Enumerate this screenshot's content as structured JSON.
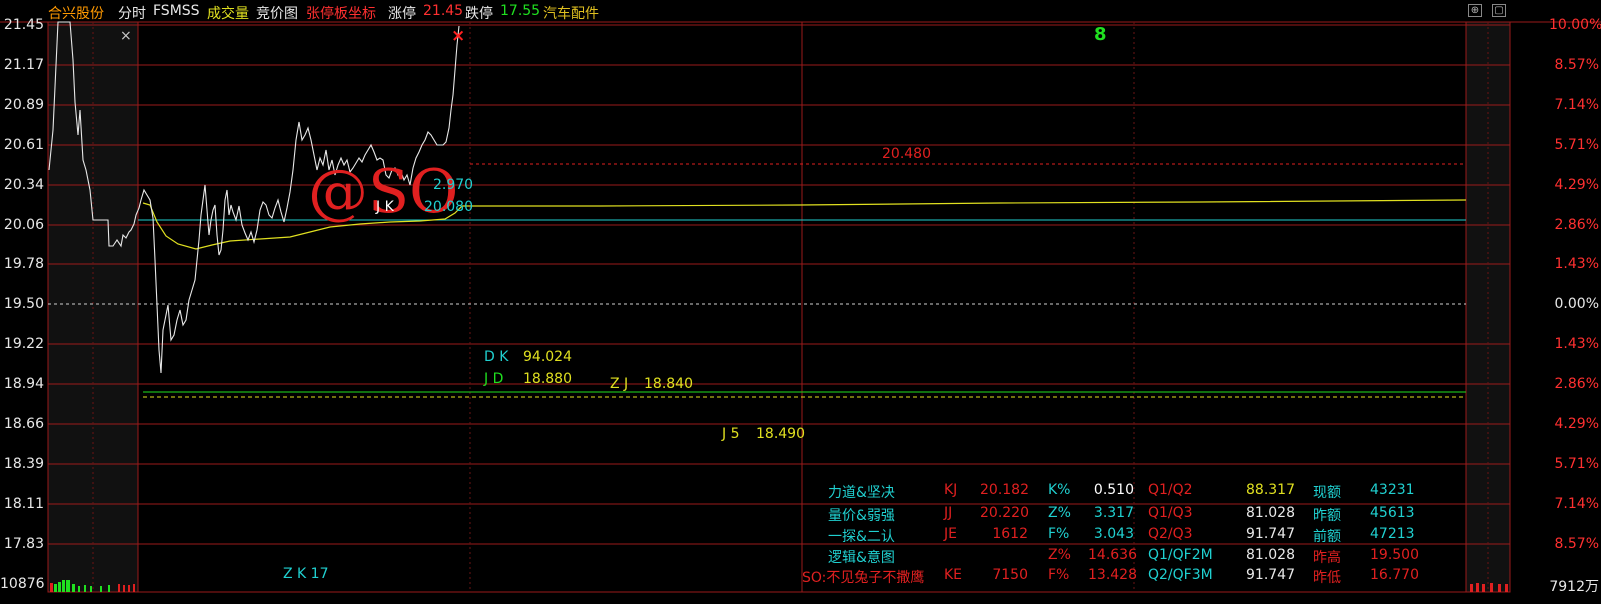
{
  "header": {
    "stock_name": "合兴股份",
    "view": "分时",
    "indicator": "FSMSS",
    "volume_tab": "成交量",
    "auction_tab": "竞价图",
    "limit_coord": "张停板坐标",
    "limit_up_label": "涨停",
    "limit_up_value": "21.45",
    "limit_down_label": "跌停",
    "limit_down_value": "17.55",
    "sector": "汽车配件"
  },
  "axis": {
    "left_prices": [
      "21.45",
      "21.17",
      "20.89",
      "20.61",
      "20.34",
      "20.06",
      "19.78",
      "19.50",
      "19.22",
      "18.94",
      "18.66",
      "18.39",
      "18.11",
      "17.83"
    ],
    "right_pcts": [
      "10.00%",
      "8.57%",
      "7.14%",
      "5.71%",
      "4.29%",
      "2.86%",
      "1.43%",
      "0.00%",
      "1.43%",
      "2.86%",
      "4.29%",
      "5.71%",
      "7.14%",
      "8.57%"
    ],
    "bottom_left": "10876",
    "bottom_right": "7912万"
  },
  "annotations": {
    "close_mark": "×",
    "red_x": "×",
    "green_8": "8",
    "watermark": "@SO",
    "jk": "J K",
    "val_2970": "2.970",
    "val_20080": "20.080",
    "red_level": "20.480",
    "dk_label": "D K",
    "dk_value": "94.024",
    "jd_label": "J D",
    "jd_value": "18.880",
    "zj_label": "Z J",
    "zj_value": "18.840",
    "j5_label": "J 5",
    "j5_value": "18.490",
    "zk": "Z K 17"
  },
  "stats": [
    {
      "title": "力道&坚决",
      "code": "KJ",
      "val": "20.182",
      "k2": "K%",
      "v2": "0.510",
      "k3": "Q1/Q2",
      "v3": "88.317",
      "k4": "现额",
      "v4": "43231"
    },
    {
      "title": "量价&弱强",
      "code": "JJ",
      "val": "20.220",
      "k2": "Z%",
      "v2": "3.317",
      "k3": "Q1/Q3",
      "v3": "81.028",
      "k4": "昨额",
      "v4": "45613"
    },
    {
      "title": "一探&二认",
      "code": "JE",
      "val": "1612",
      "k2": "F%",
      "v2": "3.043",
      "k3": "Q2/Q3",
      "v3": "91.747",
      "k4": "前额",
      "v4": "47213"
    },
    {
      "title": "逻辑&意图",
      "code": "",
      "val": "",
      "k2": "Z%",
      "v2": "14.636",
      "k3": "Q1/QF2M",
      "v3": "81.028",
      "k4": "昨高",
      "v4": "19.500"
    },
    {
      "title": "SO:不见兔子不撒鹰",
      "code": "KE",
      "val": "7150",
      "k2": "F%",
      "v2": "13.428",
      "k3": "Q2/QF3M",
      "v3": "91.747",
      "k4": "昨低",
      "v4": "16.770"
    }
  ],
  "colors": {
    "red": "#e02020",
    "green": "#20e020",
    "yellow": "#e0e020",
    "cyan": "#20d0d0",
    "white": "#e8e8e8",
    "orange": "#ff9900"
  }
}
